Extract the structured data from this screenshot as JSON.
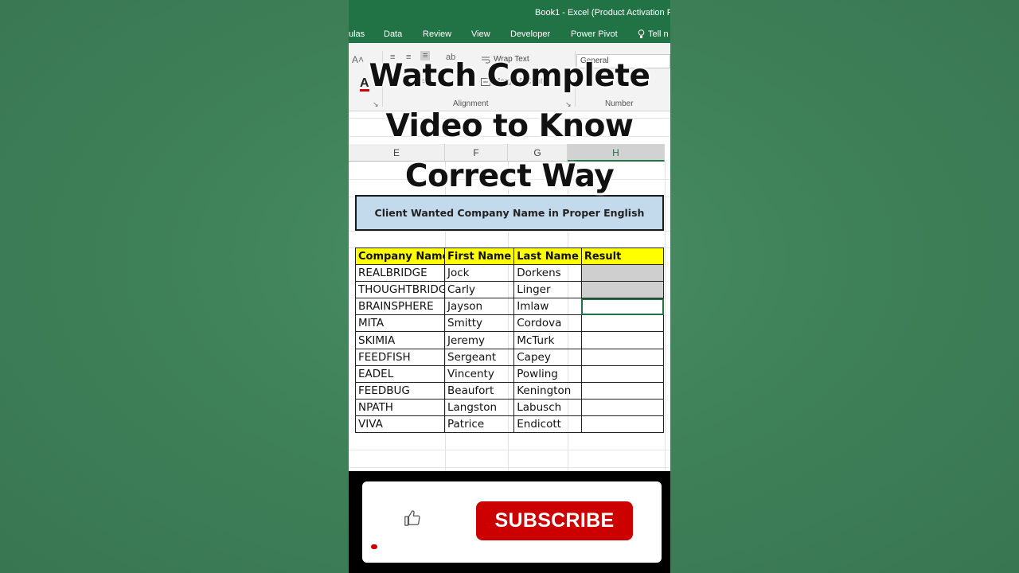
{
  "window": {
    "title": "Book1 - Excel (Product Activation F"
  },
  "ribbon_tabs": [
    {
      "label": "ulas"
    },
    {
      "label": "Data"
    },
    {
      "label": "Review"
    },
    {
      "label": "View"
    },
    {
      "label": "Developer"
    },
    {
      "label": "Power Pivot"
    },
    {
      "label": "Tell n"
    }
  ],
  "ribbon": {
    "wrap_text": "Wrap Text",
    "merge_center": "Merge & Center",
    "number_format": "General",
    "alignment_label": "Alignment",
    "number_label": "Number",
    "font_letter": "A"
  },
  "columns": [
    "E",
    "F",
    "G",
    "H"
  ],
  "banner": "Client Wanted Company Name in Proper English",
  "table": {
    "headers": [
      "Company Name",
      "First Name",
      "Last Name",
      "Result"
    ],
    "rows": [
      [
        "REALBRIDGE",
        "Jock",
        "Dorkens",
        ""
      ],
      [
        "THOUGHTBRIDGE",
        "Carly",
        "Linger",
        ""
      ],
      [
        "BRAINSPHERE",
        "Jayson",
        "Imlaw",
        ""
      ],
      [
        "MITA",
        "Smitty",
        "Cordova",
        ""
      ],
      [
        "SKIMIA",
        "Jeremy",
        "McTurk",
        ""
      ],
      [
        "FEEDFISH",
        "Sergeant",
        "Capey",
        ""
      ],
      [
        "EADEL",
        "Vincenty",
        "Powling",
        ""
      ],
      [
        "FEEDBUG",
        "Beaufort",
        "Kenington",
        ""
      ],
      [
        "NPATH",
        "Langston",
        "Labusch",
        ""
      ],
      [
        "VIVA",
        "Patrice",
        "Endicott",
        ""
      ]
    ]
  },
  "headline": [
    "Watch Complete",
    "Video to Know",
    "Correct Way"
  ],
  "subscribe_label": "SUBSCRIBE",
  "colors": {
    "excel_green": "#217346",
    "header_yellow": "#ffff00",
    "banner_blue": "#c3d9ec",
    "subscribe_red": "#cc0000",
    "background_green": "#3f8159"
  },
  "icons": [
    "lightbulb-icon",
    "thumbs-up-icon",
    "wrap-text-icon",
    "merge-center-icon",
    "font-color-icon"
  ]
}
